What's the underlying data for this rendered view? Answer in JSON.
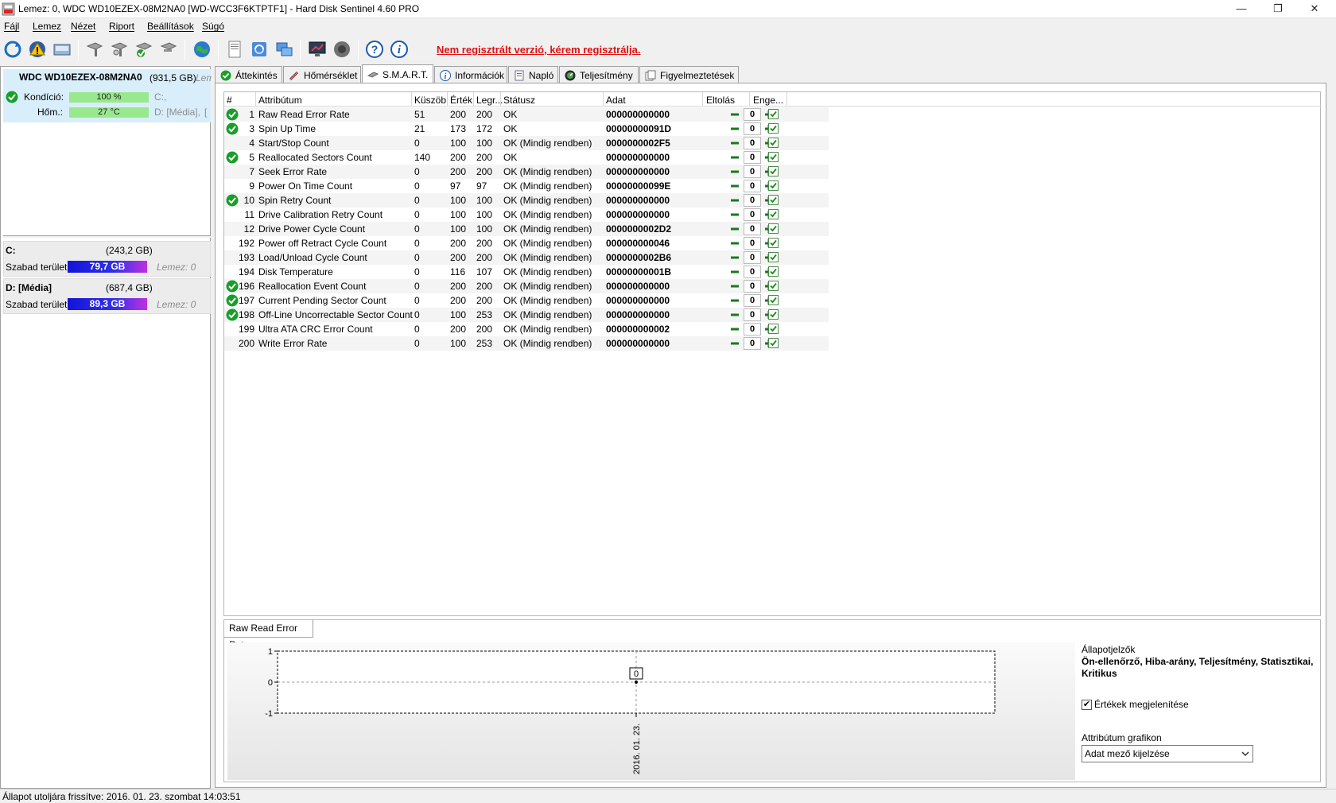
{
  "window": {
    "title": "Lemez: 0, WDC WD10EZEX-08M2NA0 [WD-WCC3F6KTPTF1]  -  Hard Disk Sentinel 4.60 PRO",
    "minimize": "—",
    "restore": "❐",
    "close": "✕"
  },
  "menu": [
    "Fájl",
    "Lemez",
    "Nézet",
    "Riport",
    "Beállítások",
    "Súgó"
  ],
  "toolbar": {
    "icons": [
      "refresh-icon",
      "alert-icon",
      "disk-icon",
      "tool-icon-1",
      "tool-icon-2",
      "tool-icon-3",
      "tool-icon-4",
      "globe-icon",
      "report-icon",
      "sync-icon",
      "network-icon",
      "monitor-icon",
      "speaker-icon",
      "help-icon",
      "info-icon"
    ],
    "register_note": "Nem regisztrált verzió, kérem regisztrálja."
  },
  "disk": {
    "name": "WDC WD10EZEX-08M2NA0",
    "size": "(931,5 GB)",
    "lem_prefix": "Lem",
    "condition_label": "Kondíció:",
    "condition_value": "100 %",
    "condition_fraction": 1.0,
    "temp_label": "Hőm.:",
    "temp_value": "27 °C",
    "vol_c": "C:,",
    "vol_d": "D: [Média],",
    "vol_trail": "[",
    "status_color": "#1a9e2a"
  },
  "volumes": [
    {
      "name": "C:",
      "size": "(243,2 GB)",
      "free_label": "Szabad terület",
      "free": "79,7 GB",
      "lemez": "Lemez: 0"
    },
    {
      "name": "D: [Média]",
      "size": "(687,4 GB)",
      "free_label": "Szabad terület",
      "free": "89,3 GB",
      "lemez": "Lemez: 0"
    }
  ],
  "tabs": [
    "Áttekintés",
    "Hőmérséklet",
    "S.M.A.R.T.",
    "Információk",
    "Napló",
    "Teljesítmény",
    "Figyelmeztetések"
  ],
  "active_tab": "S.M.A.R.T.",
  "smart": {
    "headers": {
      "num": "#",
      "attr": "Attribútum",
      "threshold": "Küszöb",
      "value": "Érték",
      "worst": "Legr...",
      "status": "Státusz",
      "data": "Adat",
      "offset": "Eltolás",
      "enable": "Enge..."
    },
    "rows": [
      {
        "ok": true,
        "id": "1",
        "attr": "Raw Read Error Rate",
        "threshold": "51",
        "value": "200",
        "worst": "200",
        "status": "OK",
        "data": "000000000000",
        "offset": "0"
      },
      {
        "ok": true,
        "id": "3",
        "attr": "Spin Up Time",
        "threshold": "21",
        "value": "173",
        "worst": "172",
        "status": "OK",
        "data": "00000000091D",
        "offset": "0"
      },
      {
        "ok": false,
        "id": "4",
        "attr": "Start/Stop Count",
        "threshold": "0",
        "value": "100",
        "worst": "100",
        "status": "OK (Mindig rendben)",
        "data": "0000000002F5",
        "offset": "0"
      },
      {
        "ok": true,
        "id": "5",
        "attr": "Reallocated Sectors Count",
        "threshold": "140",
        "value": "200",
        "worst": "200",
        "status": "OK",
        "data": "000000000000",
        "offset": "0"
      },
      {
        "ok": false,
        "id": "7",
        "attr": "Seek Error Rate",
        "threshold": "0",
        "value": "200",
        "worst": "200",
        "status": "OK (Mindig rendben)",
        "data": "000000000000",
        "offset": "0"
      },
      {
        "ok": false,
        "id": "9",
        "attr": "Power On Time Count",
        "threshold": "0",
        "value": "97",
        "worst": "97",
        "status": "OK (Mindig rendben)",
        "data": "00000000099E",
        "offset": "0"
      },
      {
        "ok": true,
        "id": "10",
        "attr": "Spin Retry Count",
        "threshold": "0",
        "value": "100",
        "worst": "100",
        "status": "OK (Mindig rendben)",
        "data": "000000000000",
        "offset": "0"
      },
      {
        "ok": false,
        "id": "11",
        "attr": "Drive Calibration Retry Count",
        "threshold": "0",
        "value": "100",
        "worst": "100",
        "status": "OK (Mindig rendben)",
        "data": "000000000000",
        "offset": "0"
      },
      {
        "ok": false,
        "id": "12",
        "attr": "Drive Power Cycle Count",
        "threshold": "0",
        "value": "100",
        "worst": "100",
        "status": "OK (Mindig rendben)",
        "data": "0000000002D2",
        "offset": "0"
      },
      {
        "ok": false,
        "id": "192",
        "attr": "Power off Retract Cycle Count",
        "threshold": "0",
        "value": "200",
        "worst": "200",
        "status": "OK (Mindig rendben)",
        "data": "000000000046",
        "offset": "0"
      },
      {
        "ok": false,
        "id": "193",
        "attr": "Load/Unload Cycle Count",
        "threshold": "0",
        "value": "200",
        "worst": "200",
        "status": "OK (Mindig rendben)",
        "data": "0000000002B6",
        "offset": "0"
      },
      {
        "ok": false,
        "id": "194",
        "attr": "Disk Temperature",
        "threshold": "0",
        "value": "116",
        "worst": "107",
        "status": "OK (Mindig rendben)",
        "data": "00000000001B",
        "offset": "0"
      },
      {
        "ok": true,
        "id": "196",
        "attr": "Reallocation Event Count",
        "threshold": "0",
        "value": "200",
        "worst": "200",
        "status": "OK (Mindig rendben)",
        "data": "000000000000",
        "offset": "0"
      },
      {
        "ok": true,
        "id": "197",
        "attr": "Current Pending Sector Count",
        "threshold": "0",
        "value": "200",
        "worst": "200",
        "status": "OK (Mindig rendben)",
        "data": "000000000000",
        "offset": "0"
      },
      {
        "ok": true,
        "id": "198",
        "attr": "Off-Line Uncorrectable Sector Count",
        "threshold": "0",
        "value": "100",
        "worst": "253",
        "status": "OK (Mindig rendben)",
        "data": "000000000000",
        "offset": "0"
      },
      {
        "ok": false,
        "id": "199",
        "attr": "Ultra ATA CRC Error Count",
        "threshold": "0",
        "value": "200",
        "worst": "200",
        "status": "OK (Mindig rendben)",
        "data": "000000000002",
        "offset": "0"
      },
      {
        "ok": false,
        "id": "200",
        "attr": "Write Error Rate",
        "threshold": "0",
        "value": "100",
        "worst": "253",
        "status": "OK (Mindig rendben)",
        "data": "000000000000",
        "offset": "0"
      }
    ]
  },
  "chart": {
    "tab_label": "Raw Read Error Rate",
    "y_ticks": [
      "1",
      "0",
      "-1"
    ],
    "point_label": "0",
    "x_label": "2016. 01. 23."
  },
  "chart_data": {
    "type": "line",
    "x": [
      "2016. 01. 23."
    ],
    "series": [
      {
        "values": [
          0
        ]
      }
    ],
    "ylim": [
      -1,
      1
    ],
    "ylabel": "",
    "xlabel": "",
    "title": "Raw Read Error Rate",
    "grid": true
  },
  "side": {
    "heading": "Állapotjelzők",
    "bold_text": "Ön-ellenőrző, Hiba-arány, Teljesítmény, Statisztikai, Kritikus",
    "show_values_label": "Értékek megjelenítése",
    "show_values_checked": true,
    "graph_label": "Attribútum grafikon",
    "graph_select": "Adat mező kijelzése"
  },
  "statusbar": "Állapot utoljára frissítve: 2016. 01. 23. szombat 14:03:51"
}
